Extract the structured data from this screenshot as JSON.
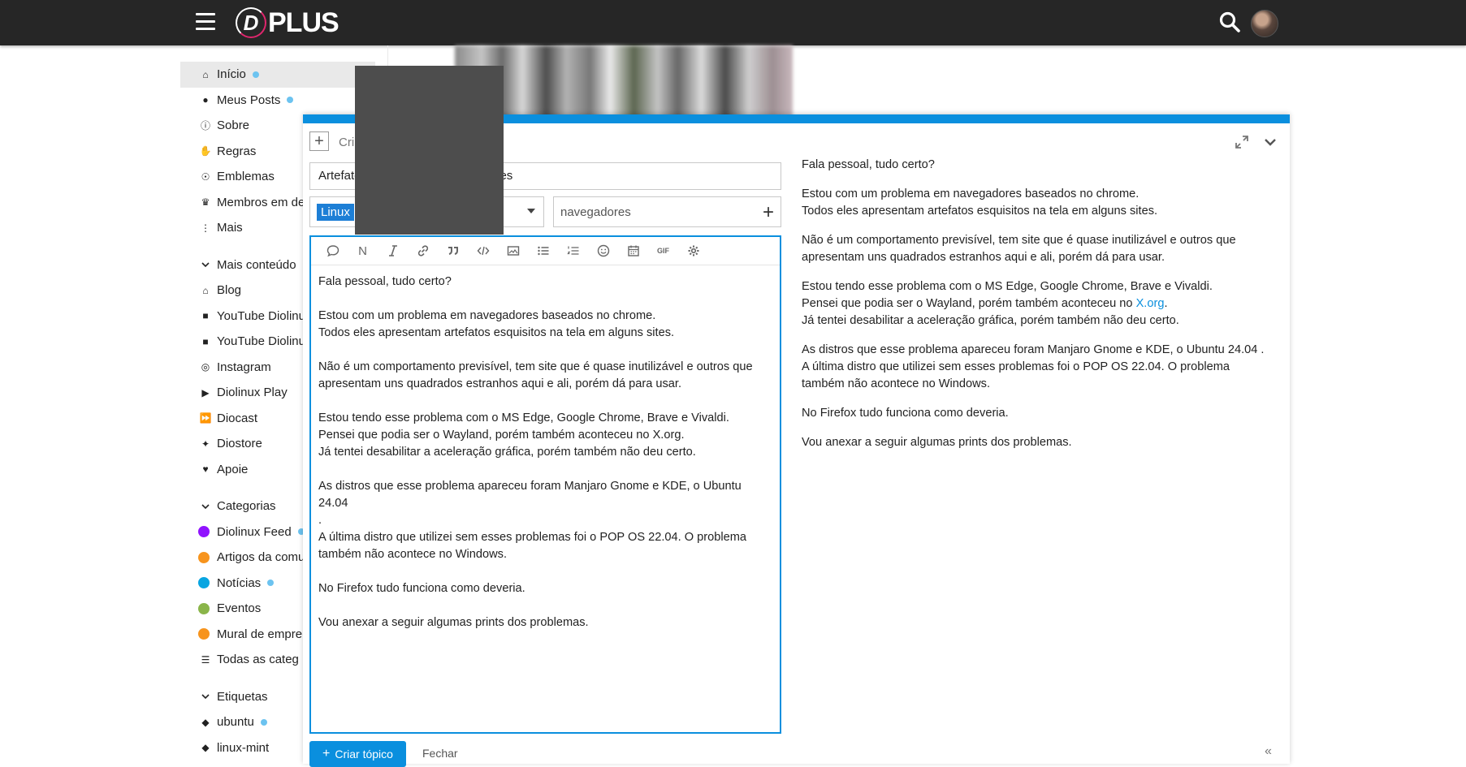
{
  "header": {
    "brand_mark": "D",
    "brand_text": "PLUS"
  },
  "sidebar": {
    "nav": [
      {
        "label": "Início",
        "icon": "home-icon",
        "unread": true
      },
      {
        "label": "Meus Posts",
        "icon": "user-icon",
        "unread": true
      },
      {
        "label": "Sobre",
        "icon": "info-icon",
        "unread": false
      },
      {
        "label": "Regras",
        "icon": "handshake-icon",
        "unread": false
      },
      {
        "label": "Emblemas",
        "icon": "medal-icon",
        "unread": false
      },
      {
        "label": "Membros em de",
        "icon": "crown-icon",
        "unread": false
      },
      {
        "label": "Mais",
        "icon": "more-vertical-icon",
        "unread": false
      }
    ],
    "more_section": {
      "heading": "Mais conteúdo",
      "items": [
        {
          "label": "Blog",
          "icon": "home-icon"
        },
        {
          "label": "YouTube Diolinu",
          "icon": "video-icon"
        },
        {
          "label": "YouTube Diolinu",
          "icon": "video-icon"
        },
        {
          "label": "Instagram",
          "icon": "instagram-icon"
        },
        {
          "label": "Diolinux Play",
          "icon": "play-icon"
        },
        {
          "label": "Diocast",
          "icon": "forward-icon"
        },
        {
          "label": "Diostore",
          "icon": "sparkle-icon"
        },
        {
          "label": "Apoie",
          "icon": "heart-icon"
        }
      ]
    },
    "categories_section": {
      "heading": "Categorias",
      "items": [
        {
          "label": "Diolinux Feed",
          "color": "#9013fe",
          "unread": true
        },
        {
          "label": "Artigos da comu",
          "color": "#f7941d",
          "unread": false
        },
        {
          "label": "Notícias",
          "color": "#08a5e1",
          "unread": true
        },
        {
          "label": "Eventos",
          "color": "#8ab54a",
          "unread": false
        },
        {
          "label": "Mural de empre",
          "color": "#f7941d",
          "unread": false
        },
        {
          "label": "Todas as categ",
          "color": "",
          "unread": false
        }
      ]
    },
    "tags_section": {
      "heading": "Etiquetas",
      "items": [
        {
          "label": "ubuntu",
          "unread": true
        },
        {
          "label": "linux-mint",
          "unread": false
        }
      ]
    }
  },
  "composer": {
    "action_label": "Cri",
    "title_value": "Artefatos Gráficos nos navegadores",
    "category": "Linux",
    "tag": "navegadores",
    "toolbar": [
      {
        "icon": "quote-bubble-icon"
      },
      {
        "icon": "heading-icon",
        "text": "N"
      },
      {
        "icon": "italic-icon"
      },
      {
        "icon": "link-icon"
      },
      {
        "icon": "blockquote-icon"
      },
      {
        "icon": "code-icon"
      },
      {
        "icon": "image-icon"
      },
      {
        "icon": "bullet-list-icon"
      },
      {
        "icon": "numbered-list-icon"
      },
      {
        "icon": "emoji-icon"
      },
      {
        "icon": "calendar-icon"
      },
      {
        "icon": "gif-icon",
        "text": "GIF"
      },
      {
        "icon": "gear-icon"
      }
    ],
    "body_raw": "Fala pessoal, tudo certo?\n\nEstou com um problema em navegadores baseados no chrome.\nTodos eles apresentam artefatos esquisitos na tela em alguns sites.\n\nNão é um comportamento previsível, tem site que é quase inutilizável e outros que\napresentam uns quadrados estranhos aqui e ali, porém dá para usar.\n\nEstou tendo esse problema com o MS Edge, Google Chrome, Brave e Vivaldi.\nPensei que podia ser o Wayland, porém também aconteceu no X.org.\nJá tentei desabilitar a aceleração gráfica, porém também não deu certo.\n\nAs distros que esse problema apareceu foram Manjaro Gnome e KDE, o Ubuntu 24.04\n.\nA última distro que utilizei sem esses problemas foi o POP OS 22.04. O problema\ntambém não acontece no Windows.\n\nNo Firefox tudo funciona como deveria.\n\nVou anexar a seguir algumas prints dos problemas.",
    "preview": {
      "p1": "Fala pessoal, tudo certo?",
      "p2": "Estou com um problema em navegadores baseados no chrome.\nTodos eles apresentam artefatos esquisitos na tela em alguns sites.",
      "p3": "Não é um comportamento previsível, tem site que é quase inutilizável e outros que\napresentam uns quadrados estranhos aqui e ali, porém dá para usar.",
      "p4a": "Estou tendo esse problema com o MS Edge, Google Chrome, Brave e Vivaldi.\nPensei que podia ser o Wayland, porém também aconteceu no ",
      "p4_link": "X.org",
      "p4b": ".\nJá tentei desabilitar a aceleração gráfica, porém também não deu certo.",
      "p5": "As distros que esse problema apareceu foram Manjaro Gnome e KDE, o Ubuntu 24.04 .\nA última distro que utilizei sem esses problemas foi o POP OS 22.04. O problema\ntambém não acontece no Windows.",
      "p6": "No Firefox tudo funciona como deveria.",
      "p7": "Vou anexar a seguir algumas prints dos problemas."
    },
    "submit_label": "Criar tópico",
    "cancel_label": "Fechar"
  },
  "colors": {
    "accent": "#0a8fde",
    "header_bg": "#262626",
    "category_badge": "#1d7fd6",
    "unread_dot": "#6cc3f0"
  }
}
